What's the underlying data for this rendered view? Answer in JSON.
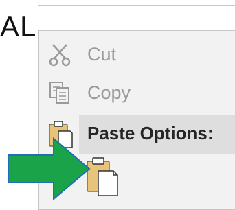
{
  "background_doc": {
    "text_fragment": "AL"
  },
  "context_menu": {
    "items": [
      {
        "id": "cut",
        "label": "Cut",
        "icon": "scissors-icon",
        "state": "disabled"
      },
      {
        "id": "copy",
        "label": "Copy",
        "icon": "copy-icon",
        "state": "disabled"
      }
    ],
    "paste_options": {
      "label": "Paste Options:",
      "header_icon": "clipboard-icon",
      "buttons": [
        {
          "id": "keep-source-formatting",
          "icon": "clipboard-paste-icon"
        }
      ]
    }
  },
  "annotation": {
    "type": "arrow",
    "color": "#1aa349",
    "points_to": "paste-option-button"
  }
}
